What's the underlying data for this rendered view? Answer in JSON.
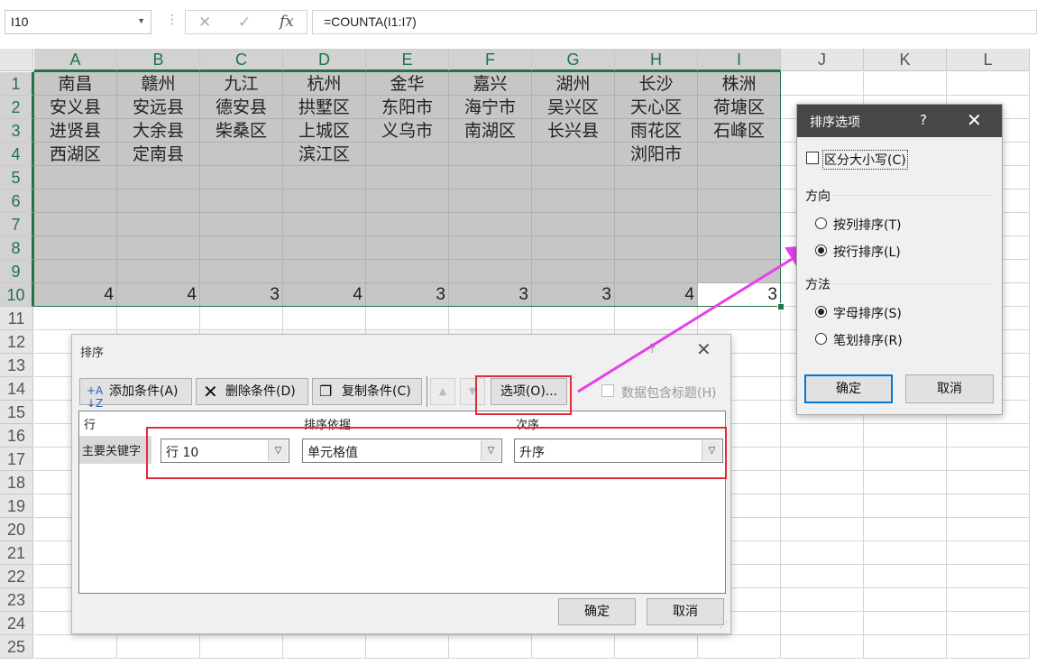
{
  "formula_bar": {
    "name_box": "I10",
    "cancel_icon": "✕",
    "enter_icon": "✓",
    "fx_label": "fx",
    "formula": "=COUNTA(I1:I7)"
  },
  "sheet": {
    "columns": [
      "A",
      "B",
      "C",
      "D",
      "E",
      "F",
      "G",
      "H",
      "I",
      "J",
      "K",
      "L"
    ],
    "rows": [
      "1",
      "2",
      "3",
      "4",
      "5",
      "6",
      "7",
      "8",
      "9",
      "10",
      "11",
      "12",
      "13",
      "14",
      "15",
      "16",
      "17",
      "18",
      "19",
      "20",
      "21",
      "22",
      "23",
      "24",
      "25"
    ],
    "cells": [
      [
        "南昌",
        "赣州",
        "九江",
        "杭州",
        "金华",
        "嘉兴",
        "湖州",
        "长沙",
        "株洲"
      ],
      [
        "安义县",
        "安远县",
        "德安县",
        "拱墅区",
        "东阳市",
        "海宁市",
        "吴兴区",
        "天心区",
        "荷塘区"
      ],
      [
        "进贤县",
        "大余县",
        "柴桑区",
        "上城区",
        "义乌市",
        "南湖区",
        "长兴县",
        "雨花区",
        "石峰区"
      ],
      [
        "西湖区",
        "定南县",
        "",
        "滨江区",
        "",
        "",
        "",
        "浏阳市",
        ""
      ],
      [
        "",
        "",
        "",
        "",
        "",
        "",
        "",
        "",
        ""
      ],
      [
        "",
        "",
        "",
        "",
        "",
        "",
        "",
        "",
        ""
      ],
      [
        "",
        "",
        "",
        "",
        "",
        "",
        "",
        "",
        ""
      ],
      [
        "",
        "",
        "",
        "",
        "",
        "",
        "",
        "",
        ""
      ],
      [
        "",
        "",
        "",
        "",
        "",
        "",
        "",
        "",
        ""
      ],
      [
        "4",
        "4",
        "3",
        "4",
        "3",
        "3",
        "3",
        "4",
        "3"
      ]
    ]
  },
  "sort_dialog": {
    "title": "排序",
    "help": "?",
    "close": "✕",
    "add_level": "添加条件(A)",
    "delete_level": "删除条件(D)",
    "copy_level": "复制条件(C)",
    "move_up": "▲",
    "move_down": "▼",
    "options": "选项(O)...",
    "my_data_has_headers": "数据包含标题(H)",
    "header_col": "行",
    "header_sort_on": "排序依据",
    "header_order": "次序",
    "row_label": "主要关键字",
    "row_value": "行 10",
    "sort_on_value": "单元格值",
    "order_value": "升序",
    "ok": "确定",
    "cancel": "取消"
  },
  "options_dialog": {
    "title": "排序选项",
    "help": "?",
    "close": "✕",
    "case_sensitive": "区分大小写(C)",
    "orientation_label": "方向",
    "sort_top_to_bottom": "按列排序(T)",
    "sort_left_to_right": "按行排序(L)",
    "method_label": "方法",
    "letter_sort": "字母排序(S)",
    "stroke_sort": "笔划排序(R)",
    "ok": "确定",
    "cancel": "取消"
  },
  "colors": {
    "accent_green": "#217346",
    "highlight_red": "#e22b36",
    "arrow_magenta": "#e83ee8"
  }
}
